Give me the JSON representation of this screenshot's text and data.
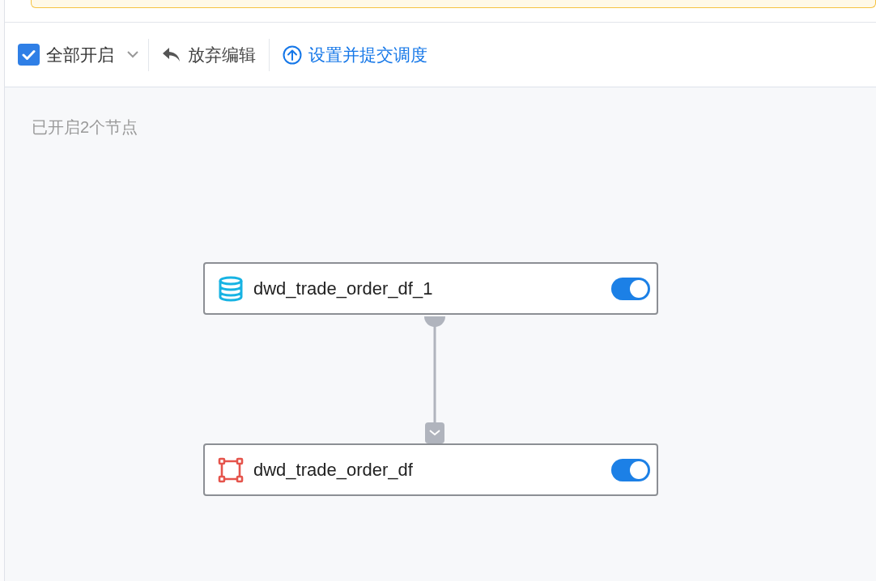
{
  "toolbar": {
    "select_all": {
      "label": "全部开启",
      "checked": true
    },
    "actions": [
      {
        "kind": "discard",
        "label": "放弃编辑"
      },
      {
        "kind": "submit",
        "label": "设置并提交调度"
      }
    ]
  },
  "summary": "已开启2个节点",
  "nodes": [
    {
      "kind": "table",
      "name": "dwd_trade_order_df_1",
      "on": true
    },
    {
      "kind": "model",
      "name": "dwd_trade_order_df",
      "on": true
    }
  ]
}
